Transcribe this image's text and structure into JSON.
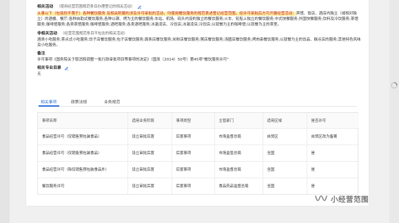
{
  "sections": {
    "related_activities": {
      "title": "相关活动",
      "note": "（使用经营范围规范条目办理登记的相关活动）",
      "text_hl": "从事以下（包括但不限于）各种餐饮服务 及相关附属的涉及许可审批的活动，均使用餐饮服务的规范表述登记经营范围，经许可审批后方可开展经营活动：",
      "text_rest": "宾馆、饭店、酒店内独立（或相对独立）的酒楼、餐厅;各种自助式餐饮服务;各种以涮、烤为主的餐饮服务;车站、机场、码头内设的独立的餐饮服务;火车、轮船上独立的餐饮服务;中式快餐服务;外国快餐服务;饮料及冷饮服务;茶馆服务;咖啡馆服务;各类茶馆服务;咖啡馆服务;酒吧服务;各类酒吧服务;冰激凌店、冷饮店;冰激凌店;冷饮店;以就餐为主的咖啡馆;以就餐为主的茶室。"
    },
    "non_related_activities": {
      "title": "非相关活动",
      "note": "（经营范围规范条目不包含的相关活动）",
      "text": "酒类小吃服务;茶点式小吃服务;饺子店餐饮服务;包子店餐饮服务;面条店餐饮服务;米粉店餐饮服务;粥店餐饮服务;汤圆店餐饮服务;烤肉串餐饮服务;以就餐为主的饮品、糕点店的服务;其他特色风味及小吃服务。"
    },
    "remarks": {
      "title": "备注",
      "text": "许可事项《国务院关于取消和调整一批行政审批项目等事项的决定》（国发〔2014〕50号）第45项\"餐饮服务许可\""
    },
    "related_catalog": {
      "title": "相关专业目录",
      "text": "无"
    }
  },
  "tabs": [
    {
      "label": "相关事项",
      "active": true
    },
    {
      "label": "政策法规",
      "active": false
    },
    {
      "label": "业务规范",
      "active": false
    }
  ],
  "table": {
    "headers": [
      "事项名称",
      "适用业务阶段",
      "事项类型",
      "主管部门",
      "适用区域",
      "是否许可"
    ],
    "rows": [
      [
        "食品经营许可（仅销售预包装食品）",
        "设立审批后置",
        "后置事项",
        "市场监督总局",
        "自贸区",
        "自贸区改为备案"
      ],
      [
        "食品经营许可（仅销售预包装食品）",
        "设立审批后置",
        "后置事项",
        "市场监管总局",
        "全国",
        "是"
      ],
      [
        "食品经营许可（除仅销售预包装食品外）",
        "设立审批后置",
        "后置事项",
        "市场监督总局",
        "全国",
        "是"
      ],
      [
        "餐饮服务许可",
        "设立审批后置",
        "后置事项",
        "食品药品监督总局",
        "全国",
        "是"
      ]
    ]
  },
  "watermark": {
    "text": "小经营范围",
    "icon": "wechat-channel-icon"
  },
  "colors": {
    "accent": "#2f6bd6",
    "highlight_bg": "#fff1a6",
    "highlight_text": "#c0161b"
  }
}
